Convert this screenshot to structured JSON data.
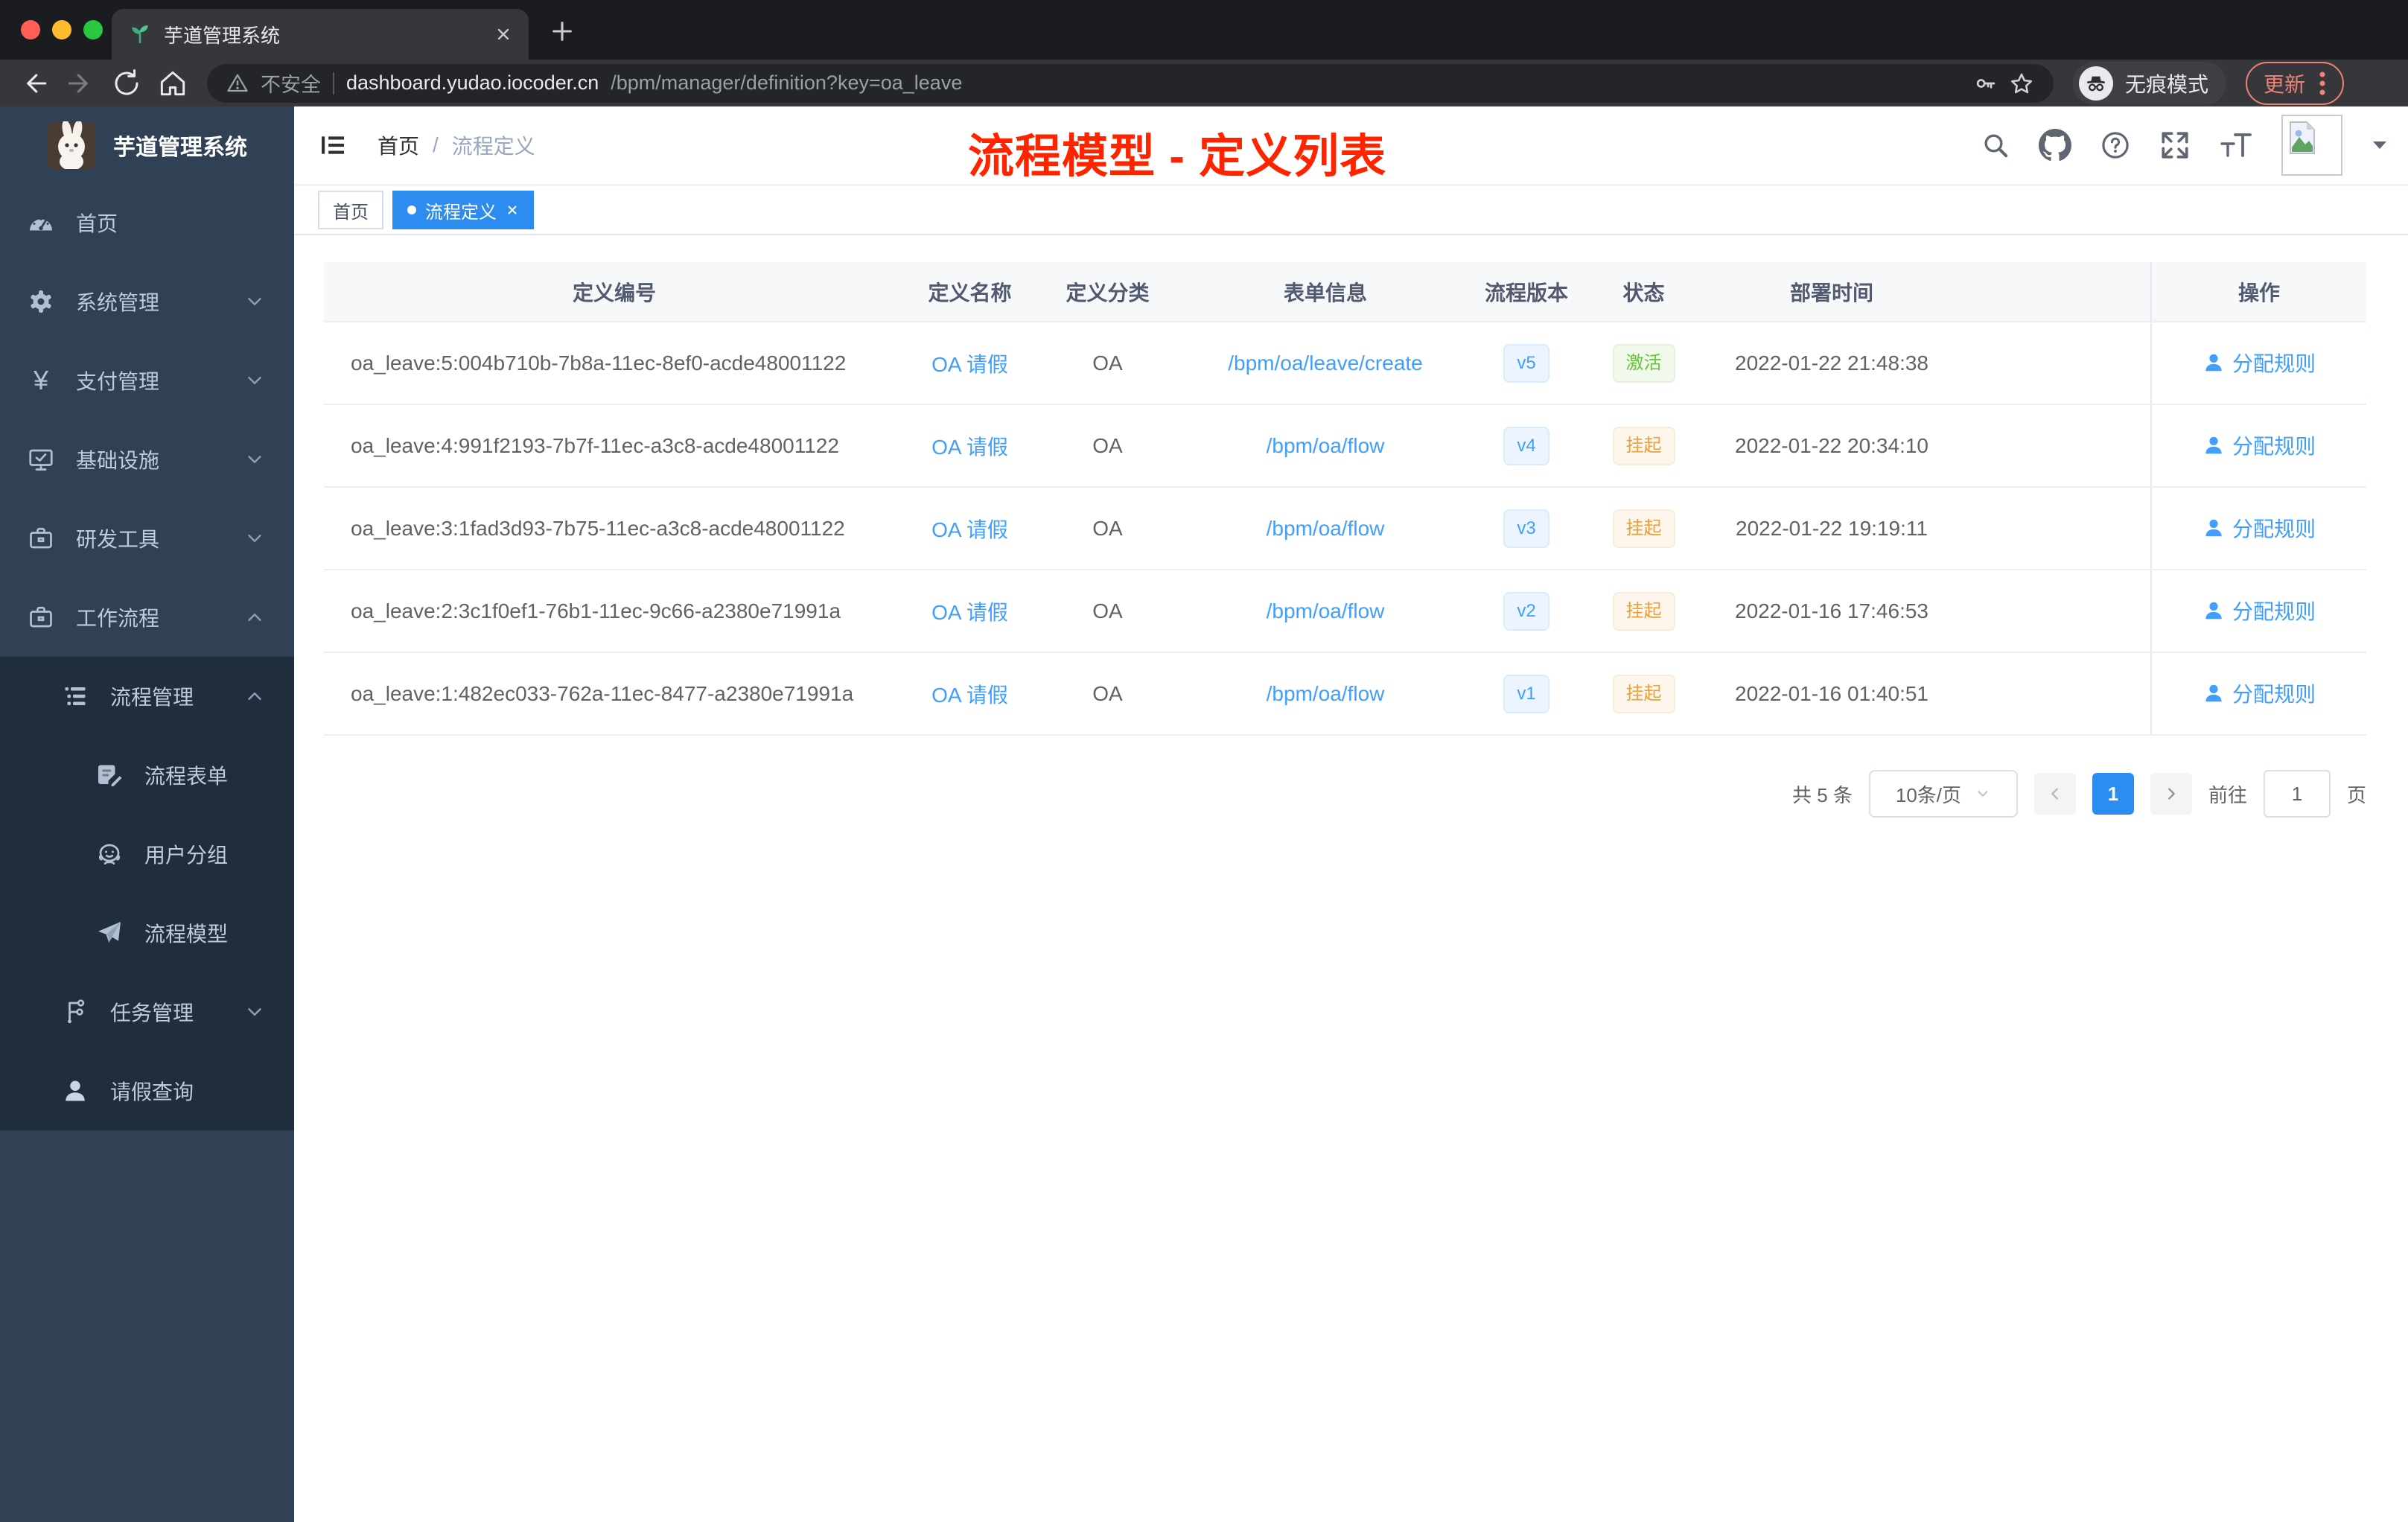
{
  "browser": {
    "tab_title": "芋道管理系统",
    "security_label": "不安全",
    "url_host": "dashboard.yudao.iocoder.cn",
    "url_path": "/bpm/manager/definition?key=oa_leave",
    "incognito_label": "无痕模式",
    "update_label": "更新"
  },
  "sidebar": {
    "logo_title": "芋道管理系统",
    "items": [
      {
        "key": "home",
        "label": "首页",
        "icon": "dashboard-icon",
        "level": 1,
        "expand": null,
        "dark": false
      },
      {
        "key": "system-management",
        "label": "系统管理",
        "icon": "gear-icon",
        "level": 1,
        "expand": "down",
        "dark": false
      },
      {
        "key": "payment-management",
        "label": "支付管理",
        "icon": "yen-icon",
        "level": 1,
        "expand": "down",
        "dark": false
      },
      {
        "key": "infrastructure",
        "label": "基础设施",
        "icon": "monitor-check-icon",
        "level": 1,
        "expand": "down",
        "dark": false
      },
      {
        "key": "dev-tools",
        "label": "研发工具",
        "icon": "briefcase-icon",
        "level": 1,
        "expand": "down",
        "dark": false
      },
      {
        "key": "workflow",
        "label": "工作流程",
        "icon": "briefcase-icon",
        "level": 1,
        "expand": "up",
        "dark": false
      },
      {
        "key": "process-management",
        "label": "流程管理",
        "icon": "list-tree-icon",
        "level": 2,
        "expand": "up",
        "dark": true
      },
      {
        "key": "process-form",
        "label": "流程表单",
        "icon": "form-edit-icon",
        "level": 3,
        "expand": null,
        "dark": true
      },
      {
        "key": "user-group",
        "label": "用户分组",
        "icon": "user-group-icon",
        "level": 3,
        "expand": null,
        "dark": true
      },
      {
        "key": "process-model",
        "label": "流程模型",
        "icon": "paper-plane-icon",
        "level": 3,
        "expand": null,
        "dark": true
      },
      {
        "key": "task-management",
        "label": "任务管理",
        "icon": "org-tree-icon",
        "level": 2,
        "expand": "down",
        "dark": true
      },
      {
        "key": "leave-query",
        "label": "请假查询",
        "icon": "person-icon",
        "level": 2,
        "expand": null,
        "dark": true
      }
    ]
  },
  "navbar": {
    "breadcrumb": [
      "首页",
      "流程定义"
    ],
    "separator": "/",
    "annotation": "流程模型 - 定义列表"
  },
  "tags": [
    {
      "label": "首页",
      "active": false,
      "closable": false
    },
    {
      "label": "流程定义",
      "active": true,
      "closable": true
    }
  ],
  "table": {
    "columns": [
      "定义编号",
      "定义名称",
      "定义分类",
      "表单信息",
      "流程版本",
      "状态",
      "部署时间",
      "操作"
    ],
    "action_label": "分配规则",
    "rows": [
      {
        "id": "oa_leave:5:004b710b-7b8a-11ec-8ef0-acde48001122",
        "name": "OA 请假",
        "category": "OA",
        "form": "/bpm/oa/leave/create",
        "version": "v5",
        "status": "激活",
        "status_type": "success",
        "deployed_at": "2022-01-22 21:48:38"
      },
      {
        "id": "oa_leave:4:991f2193-7b7f-11ec-a3c8-acde48001122",
        "name": "OA 请假",
        "category": "OA",
        "form": "/bpm/oa/flow",
        "version": "v4",
        "status": "挂起",
        "status_type": "warning",
        "deployed_at": "2022-01-22 20:34:10"
      },
      {
        "id": "oa_leave:3:1fad3d93-7b75-11ec-a3c8-acde48001122",
        "name": "OA 请假",
        "category": "OA",
        "form": "/bpm/oa/flow",
        "version": "v3",
        "status": "挂起",
        "status_type": "warning",
        "deployed_at": "2022-01-22 19:19:11"
      },
      {
        "id": "oa_leave:2:3c1f0ef1-76b1-11ec-9c66-a2380e71991a",
        "name": "OA 请假",
        "category": "OA",
        "form": "/bpm/oa/flow",
        "version": "v2",
        "status": "挂起",
        "status_type": "warning",
        "deployed_at": "2022-01-16 17:46:53"
      },
      {
        "id": "oa_leave:1:482ec033-762a-11ec-8477-a2380e71991a",
        "name": "OA 请假",
        "category": "OA",
        "form": "/bpm/oa/flow",
        "version": "v1",
        "status": "挂起",
        "status_type": "warning",
        "deployed_at": "2022-01-16 01:40:51"
      }
    ]
  },
  "pagination": {
    "total_label": "共 5 条",
    "page_size_label": "10条/页",
    "current_page": "1",
    "goto_label": "前往",
    "goto_value": "1",
    "page_unit": "页"
  },
  "colors": {
    "accent_blue": "#409eff",
    "tag_active_blue": "#2d8cf0",
    "annotation_red": "#fe2400",
    "success_green": "#67c23a",
    "warning_orange": "#e6a23c",
    "sidebar_bg": "#304156",
    "sidebar_submenu_bg": "#1f2d3d"
  }
}
